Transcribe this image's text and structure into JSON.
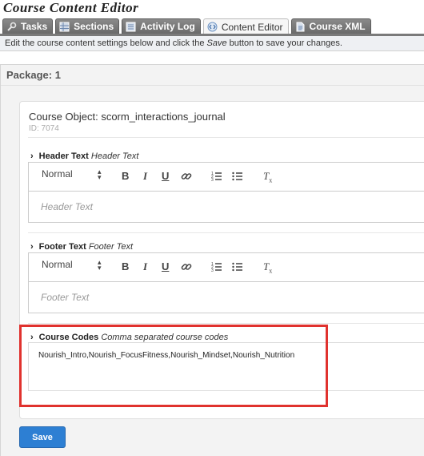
{
  "app_title": "Course Content Editor",
  "tabs": [
    {
      "label": "Tasks",
      "icon": "wrench-icon"
    },
    {
      "label": "Sections",
      "icon": "grid-icon"
    },
    {
      "label": "Activity Log",
      "icon": "list-icon"
    },
    {
      "label": "Content Editor",
      "icon": "code-icon",
      "active": true
    },
    {
      "label": "Course XML",
      "icon": "document-icon"
    }
  ],
  "info": {
    "prefix": "Edit the course content settings below and click the ",
    "save_word": "Save",
    "suffix": " button to save your changes."
  },
  "package_title": "Package: 1",
  "course_object": {
    "title": "Course Object: scorm_interactions_journal",
    "id_text": "ID: 7074"
  },
  "header_section": {
    "label": "Header Text",
    "hint": "Header Text",
    "format": "Normal",
    "placeholder": "Header Text"
  },
  "footer_section": {
    "label": "Footer Text",
    "hint": "Footer Text",
    "format": "Normal",
    "placeholder": "Footer Text"
  },
  "codes_section": {
    "label": "Course Codes",
    "hint": "Comma separated course codes",
    "value": "Nourish_Intro,Nourish_FocusFitness,Nourish_Mindset,Nourish_Nutrition"
  },
  "toolbar": {
    "bold": "B",
    "italic": "I",
    "underline": "U",
    "clear": "T"
  },
  "save_label": "Save",
  "colors": {
    "tab_bg": "#7a7a7a",
    "save_button": "#2d7fd3",
    "highlight": "#e0322e"
  }
}
